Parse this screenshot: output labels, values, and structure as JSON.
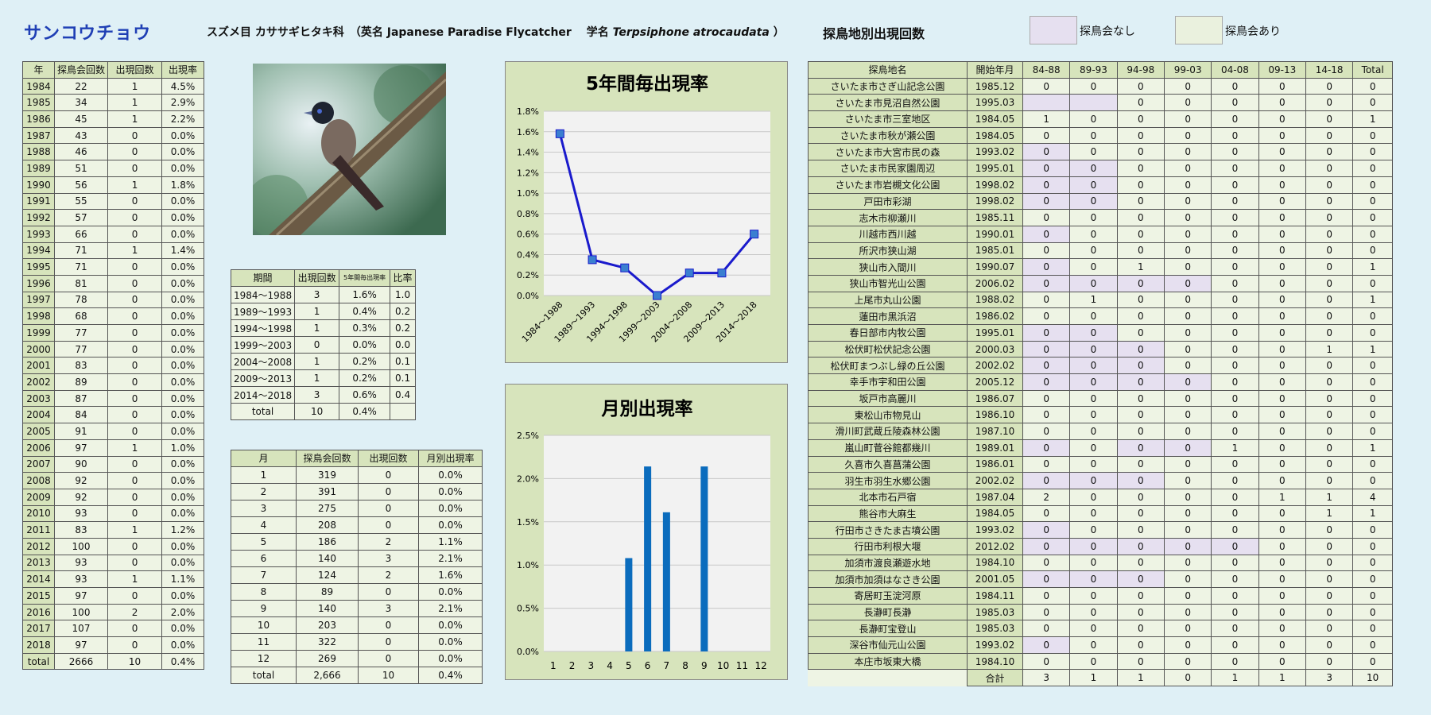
{
  "header": {
    "title": "サンコウチョウ",
    "subtitle_prefix": "スズメ目 カササギヒタキ科　（英名 Japanese Paradise Flycatcher　 学名",
    "subtitle_latin": "Terpsiphone atrocaudata",
    "subtitle_suffix": "）",
    "section_title": "探鳥地別出現回数",
    "legend_none": "探鳥会なし",
    "legend_some": "探鳥会あり",
    "colors": {
      "title": "#1f3fb5",
      "no_event": "#e6e0f0",
      "event": "#eaf1de",
      "header_cell": "#d7e4bc",
      "line": "#1a1acc",
      "bar": "#0b6cbd"
    }
  },
  "year_table": {
    "headers": [
      "年",
      "探鳥会回数",
      "出現回数",
      "出現率"
    ],
    "rows": [
      [
        "1984",
        "22",
        "1",
        "4.5%"
      ],
      [
        "1985",
        "34",
        "1",
        "2.9%"
      ],
      [
        "1986",
        "45",
        "1",
        "2.2%"
      ],
      [
        "1987",
        "43",
        "0",
        "0.0%"
      ],
      [
        "1988",
        "46",
        "0",
        "0.0%"
      ],
      [
        "1989",
        "51",
        "0",
        "0.0%"
      ],
      [
        "1990",
        "56",
        "1",
        "1.8%"
      ],
      [
        "1991",
        "55",
        "0",
        "0.0%"
      ],
      [
        "1992",
        "57",
        "0",
        "0.0%"
      ],
      [
        "1993",
        "66",
        "0",
        "0.0%"
      ],
      [
        "1994",
        "71",
        "1",
        "1.4%"
      ],
      [
        "1995",
        "71",
        "0",
        "0.0%"
      ],
      [
        "1996",
        "81",
        "0",
        "0.0%"
      ],
      [
        "1997",
        "78",
        "0",
        "0.0%"
      ],
      [
        "1998",
        "68",
        "0",
        "0.0%"
      ],
      [
        "1999",
        "77",
        "0",
        "0.0%"
      ],
      [
        "2000",
        "77",
        "0",
        "0.0%"
      ],
      [
        "2001",
        "83",
        "0",
        "0.0%"
      ],
      [
        "2002",
        "89",
        "0",
        "0.0%"
      ],
      [
        "2003",
        "87",
        "0",
        "0.0%"
      ],
      [
        "2004",
        "84",
        "0",
        "0.0%"
      ],
      [
        "2005",
        "91",
        "0",
        "0.0%"
      ],
      [
        "2006",
        "97",
        "1",
        "1.0%"
      ],
      [
        "2007",
        "90",
        "0",
        "0.0%"
      ],
      [
        "2008",
        "92",
        "0",
        "0.0%"
      ],
      [
        "2009",
        "92",
        "0",
        "0.0%"
      ],
      [
        "2010",
        "93",
        "0",
        "0.0%"
      ],
      [
        "2011",
        "83",
        "1",
        "1.2%"
      ],
      [
        "2012",
        "100",
        "0",
        "0.0%"
      ],
      [
        "2013",
        "93",
        "0",
        "0.0%"
      ],
      [
        "2014",
        "93",
        "1",
        "1.1%"
      ],
      [
        "2015",
        "97",
        "0",
        "0.0%"
      ],
      [
        "2016",
        "100",
        "2",
        "2.0%"
      ],
      [
        "2017",
        "107",
        "0",
        "0.0%"
      ],
      [
        "2018",
        "97",
        "0",
        "0.0%"
      ],
      [
        "total",
        "2666",
        "10",
        "0.4%"
      ]
    ]
  },
  "period_table": {
    "headers": [
      "期間",
      "出現回数",
      "5年間毎出現率",
      "比率"
    ],
    "rows": [
      [
        "1984～1988",
        "3",
        "1.6%",
        "1.0"
      ],
      [
        "1989～1993",
        "1",
        "0.4%",
        "0.2"
      ],
      [
        "1994～1998",
        "1",
        "0.3%",
        "0.2"
      ],
      [
        "1999～2003",
        "0",
        "0.0%",
        "0.0"
      ],
      [
        "2004～2008",
        "1",
        "0.2%",
        "0.1"
      ],
      [
        "2009～2013",
        "1",
        "0.2%",
        "0.1"
      ],
      [
        "2014～2018",
        "3",
        "0.6%",
        "0.4"
      ],
      [
        "total",
        "10",
        "0.4%",
        ""
      ]
    ]
  },
  "month_table": {
    "headers": [
      "月",
      "探鳥会回数",
      "出現回数",
      "月別出現率"
    ],
    "rows": [
      [
        "1",
        "319",
        "0",
        "0.0%"
      ],
      [
        "2",
        "391",
        "0",
        "0.0%"
      ],
      [
        "3",
        "275",
        "0",
        "0.0%"
      ],
      [
        "4",
        "208",
        "0",
        "0.0%"
      ],
      [
        "5",
        "186",
        "2",
        "1.1%"
      ],
      [
        "6",
        "140",
        "3",
        "2.1%"
      ],
      [
        "7",
        "124",
        "2",
        "1.6%"
      ],
      [
        "8",
        "89",
        "0",
        "0.0%"
      ],
      [
        "9",
        "140",
        "3",
        "2.1%"
      ],
      [
        "10",
        "203",
        "0",
        "0.0%"
      ],
      [
        "11",
        "322",
        "0",
        "0.0%"
      ],
      [
        "12",
        "269",
        "0",
        "0.0%"
      ],
      [
        "total",
        "2,666",
        "10",
        "0.4%"
      ]
    ]
  },
  "site_table": {
    "headers": [
      "探鳥地名",
      "開始年月",
      "84-88",
      "89-93",
      "94-98",
      "99-03",
      "04-08",
      "09-13",
      "14-18",
      "Total"
    ],
    "rows": [
      {
        "name": "さいたま市さぎ山記念公園",
        "start": "1985.12",
        "vals": [
          "0",
          "0",
          "0",
          "0",
          "0",
          "0",
          "0",
          "0"
        ],
        "none": []
      },
      {
        "name": "さいたま市見沼自然公園",
        "start": "1995.03",
        "vals": [
          "",
          "",
          "0",
          "0",
          "0",
          "0",
          "0",
          "0"
        ],
        "none": [
          0,
          1
        ]
      },
      {
        "name": "さいたま市三室地区",
        "start": "1984.05",
        "vals": [
          "1",
          "0",
          "0",
          "0",
          "0",
          "0",
          "0",
          "1"
        ],
        "none": []
      },
      {
        "name": "さいたま市秋が瀬公園",
        "start": "1984.05",
        "vals": [
          "0",
          "0",
          "0",
          "0",
          "0",
          "0",
          "0",
          "0"
        ],
        "none": []
      },
      {
        "name": "さいたま市大宮市民の森",
        "start": "1993.02",
        "vals": [
          "0",
          "0",
          "0",
          "0",
          "0",
          "0",
          "0",
          "0"
        ],
        "none": [
          0
        ]
      },
      {
        "name": "さいたま市民家園周辺",
        "start": "1995.01",
        "vals": [
          "0",
          "0",
          "0",
          "0",
          "0",
          "0",
          "0",
          "0"
        ],
        "none": [
          0,
          1
        ]
      },
      {
        "name": "さいたま市岩槻文化公園",
        "start": "1998.02",
        "vals": [
          "0",
          "0",
          "0",
          "0",
          "0",
          "0",
          "0",
          "0"
        ],
        "none": [
          0,
          1
        ]
      },
      {
        "name": "戸田市彩湖",
        "start": "1998.02",
        "vals": [
          "0",
          "0",
          "0",
          "0",
          "0",
          "0",
          "0",
          "0"
        ],
        "none": [
          0,
          1
        ]
      },
      {
        "name": "志木市柳瀬川",
        "start": "1985.11",
        "vals": [
          "0",
          "0",
          "0",
          "0",
          "0",
          "0",
          "0",
          "0"
        ],
        "none": []
      },
      {
        "name": "川越市西川越",
        "start": "1990.01",
        "vals": [
          "0",
          "0",
          "0",
          "0",
          "0",
          "0",
          "0",
          "0"
        ],
        "none": [
          0
        ]
      },
      {
        "name": "所沢市狭山湖",
        "start": "1985.01",
        "vals": [
          "0",
          "0",
          "0",
          "0",
          "0",
          "0",
          "0",
          "0"
        ],
        "none": []
      },
      {
        "name": "狭山市入間川",
        "start": "1990.07",
        "vals": [
          "0",
          "0",
          "1",
          "0",
          "0",
          "0",
          "0",
          "1"
        ],
        "none": [
          0
        ]
      },
      {
        "name": "狭山市智光山公園",
        "start": "2006.02",
        "vals": [
          "0",
          "0",
          "0",
          "0",
          "0",
          "0",
          "0",
          "0"
        ],
        "none": [
          0,
          1,
          2,
          3
        ]
      },
      {
        "name": "上尾市丸山公園",
        "start": "1988.02",
        "vals": [
          "0",
          "1",
          "0",
          "0",
          "0",
          "0",
          "0",
          "1"
        ],
        "none": []
      },
      {
        "name": "蓮田市黒浜沼",
        "start": "1986.02",
        "vals": [
          "0",
          "0",
          "0",
          "0",
          "0",
          "0",
          "0",
          "0"
        ],
        "none": []
      },
      {
        "name": "春日部市内牧公園",
        "start": "1995.01",
        "vals": [
          "0",
          "0",
          "0",
          "0",
          "0",
          "0",
          "0",
          "0"
        ],
        "none": [
          0,
          1
        ]
      },
      {
        "name": "松伏町松伏記念公園",
        "start": "2000.03",
        "vals": [
          "0",
          "0",
          "0",
          "0",
          "0",
          "0",
          "1",
          "1"
        ],
        "none": [
          0,
          1,
          2
        ]
      },
      {
        "name": "松伏町まつぶし緑の丘公園",
        "start": "2002.02",
        "vals": [
          "0",
          "0",
          "0",
          "0",
          "0",
          "0",
          "0",
          "0"
        ],
        "none": [
          0,
          1,
          2
        ]
      },
      {
        "name": "幸手市宇和田公園",
        "start": "2005.12",
        "vals": [
          "0",
          "0",
          "0",
          "0",
          "0",
          "0",
          "0",
          "0"
        ],
        "none": [
          0,
          1,
          2,
          3
        ]
      },
      {
        "name": "坂戸市高麗川",
        "start": "1986.07",
        "vals": [
          "0",
          "0",
          "0",
          "0",
          "0",
          "0",
          "0",
          "0"
        ],
        "none": []
      },
      {
        "name": "東松山市物見山",
        "start": "1986.10",
        "vals": [
          "0",
          "0",
          "0",
          "0",
          "0",
          "0",
          "0",
          "0"
        ],
        "none": []
      },
      {
        "name": "滑川町武蔵丘陵森林公園",
        "start": "1987.10",
        "vals": [
          "0",
          "0",
          "0",
          "0",
          "0",
          "0",
          "0",
          "0"
        ],
        "none": []
      },
      {
        "name": "嵐山町菅谷館都幾川",
        "start": "1989.01",
        "vals": [
          "0",
          "0",
          "0",
          "0",
          "1",
          "0",
          "0",
          "1"
        ],
        "none": [
          0,
          2,
          3
        ]
      },
      {
        "name": "久喜市久喜菖蒲公園",
        "start": "1986.01",
        "vals": [
          "0",
          "0",
          "0",
          "0",
          "0",
          "0",
          "0",
          "0"
        ],
        "none": []
      },
      {
        "name": "羽生市羽生水郷公園",
        "start": "2002.02",
        "vals": [
          "0",
          "0",
          "0",
          "0",
          "0",
          "0",
          "0",
          "0"
        ],
        "none": [
          0,
          1,
          2
        ]
      },
      {
        "name": "北本市石戸宿",
        "start": "1987.04",
        "vals": [
          "2",
          "0",
          "0",
          "0",
          "0",
          "1",
          "1",
          "4"
        ],
        "none": []
      },
      {
        "name": "熊谷市大麻生",
        "start": "1984.05",
        "vals": [
          "0",
          "0",
          "0",
          "0",
          "0",
          "0",
          "1",
          "1"
        ],
        "none": []
      },
      {
        "name": "行田市さきたま古墳公園",
        "start": "1993.02",
        "vals": [
          "0",
          "0",
          "0",
          "0",
          "0",
          "0",
          "0",
          "0"
        ],
        "none": [
          0
        ]
      },
      {
        "name": "行田市利根大堰",
        "start": "2012.02",
        "vals": [
          "0",
          "0",
          "0",
          "0",
          "0",
          "0",
          "0",
          "0"
        ],
        "none": [
          0,
          1,
          2,
          3,
          4
        ]
      },
      {
        "name": "加須市渡良瀬遊水地",
        "start": "1984.10",
        "vals": [
          "0",
          "0",
          "0",
          "0",
          "0",
          "0",
          "0",
          "0"
        ],
        "none": []
      },
      {
        "name": "加須市加須はなさき公園",
        "start": "2001.05",
        "vals": [
          "0",
          "0",
          "0",
          "0",
          "0",
          "0",
          "0",
          "0"
        ],
        "none": [
          0,
          1,
          2
        ]
      },
      {
        "name": "寄居町玉淀河原",
        "start": "1984.11",
        "vals": [
          "0",
          "0",
          "0",
          "0",
          "0",
          "0",
          "0",
          "0"
        ],
        "none": []
      },
      {
        "name": "長瀞町長瀞",
        "start": "1985.03",
        "vals": [
          "0",
          "0",
          "0",
          "0",
          "0",
          "0",
          "0",
          "0"
        ],
        "none": []
      },
      {
        "name": "長瀞町宝登山",
        "start": "1985.03",
        "vals": [
          "0",
          "0",
          "0",
          "0",
          "0",
          "0",
          "0",
          "0"
        ],
        "none": []
      },
      {
        "name": "深谷市仙元山公園",
        "start": "1993.02",
        "vals": [
          "0",
          "0",
          "0",
          "0",
          "0",
          "0",
          "0",
          "0"
        ],
        "none": [
          0
        ]
      },
      {
        "name": "本庄市坂東大橋",
        "start": "1984.10",
        "vals": [
          "0",
          "0",
          "0",
          "0",
          "0",
          "0",
          "0",
          "0"
        ],
        "none": []
      }
    ],
    "total_label": "合計",
    "totals": [
      "3",
      "1",
      "1",
      "0",
      "1",
      "1",
      "3",
      "10"
    ]
  },
  "chart_data": [
    {
      "type": "line",
      "title": "5年間毎出現率",
      "categories": [
        "1984～1988",
        "1989～1993",
        "1994～1998",
        "1999～2003",
        "2004～2008",
        "2009～2013",
        "2014～2018"
      ],
      "values": [
        1.58,
        0.35,
        0.27,
        0.0,
        0.22,
        0.22,
        0.6
      ],
      "ylim": [
        0,
        1.8
      ],
      "yticks": [
        "0.0%",
        "0.2%",
        "0.4%",
        "0.6%",
        "0.8%",
        "1.0%",
        "1.2%",
        "1.4%",
        "1.6%",
        "1.8%"
      ],
      "grid": true
    },
    {
      "type": "bar",
      "title": "月別出現率",
      "categories": [
        "1",
        "2",
        "3",
        "4",
        "5",
        "6",
        "7",
        "8",
        "9",
        "10",
        "11",
        "12"
      ],
      "values": [
        0,
        0,
        0,
        0,
        1.08,
        2.14,
        1.61,
        0,
        2.14,
        0,
        0,
        0
      ],
      "ylim": [
        0,
        2.5
      ],
      "yticks": [
        "0.0%",
        "0.5%",
        "1.0%",
        "1.5%",
        "2.0%",
        "2.5%"
      ],
      "grid": true
    }
  ]
}
